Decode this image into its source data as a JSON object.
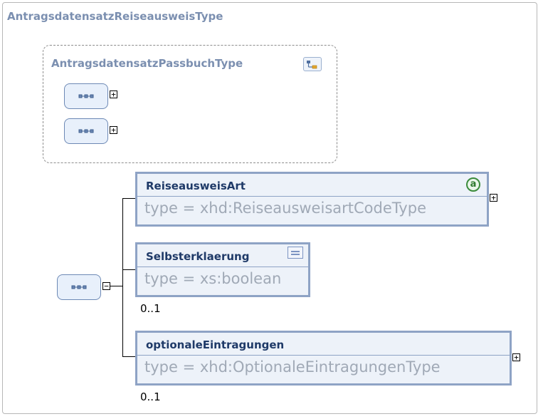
{
  "outer": {
    "title": "AntragsdatensatzReiseausweisType"
  },
  "group": {
    "title": "AntragsdatensatzPassbuchType",
    "icon": "complex-type-icon",
    "sequences": [
      {
        "icon": "sequence-icon",
        "expander": "+"
      },
      {
        "icon": "sequence-icon",
        "expander": "+"
      }
    ]
  },
  "main_sequence": {
    "icon": "sequence-icon",
    "expander": "−"
  },
  "elements": [
    {
      "name": "ReiseausweisArt",
      "type": "type = xhd:ReiseausweisartCodeType",
      "badge_icon": "attribute-icon",
      "badge_text": "a",
      "expander": "+",
      "occurrence": ""
    },
    {
      "name": "Selbsterklaerung",
      "type": "type = xs:boolean",
      "badge_icon": "documentation-icon",
      "expander": "",
      "occurrence": "0..1"
    },
    {
      "name": "optionaleEintragungen",
      "type": "type = xhd:OptionaleEintragungenType",
      "badge_icon": "",
      "expander": "+",
      "occurrence": "0..1"
    }
  ],
  "colors": {
    "element_border": "#8ea3c5",
    "element_fill": "#edf2f9",
    "title_text": "#7b8fb0",
    "type_text": "#a0a9b6"
  }
}
